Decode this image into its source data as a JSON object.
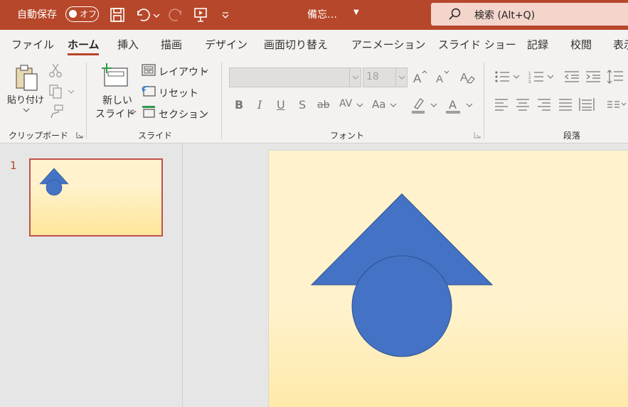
{
  "titlebar": {
    "autosave_label": "自動保存",
    "autosave_state": "オフ",
    "filename": "備忘…",
    "search_placeholder": "検索 (Alt+Q)",
    "accent_color": "#b7472a"
  },
  "tabs": [
    {
      "label": "ファイル",
      "active": false
    },
    {
      "label": "ホーム",
      "active": true
    },
    {
      "label": "挿入",
      "active": false
    },
    {
      "label": "描画",
      "active": false
    },
    {
      "label": "デザイン",
      "active": false
    },
    {
      "label": "画面切り替え",
      "active": false
    },
    {
      "label": "アニメーション",
      "active": false
    },
    {
      "label": "スライド ショー",
      "active": false
    },
    {
      "label": "記録",
      "active": false
    },
    {
      "label": "校閲",
      "active": false
    },
    {
      "label": "表示",
      "active": false
    }
  ],
  "ribbon": {
    "clipboard": {
      "paste_label_line1": "貼り付け",
      "group_label": "クリップボード"
    },
    "slides": {
      "new_slide_line1": "新しい",
      "new_slide_line2": "スライド",
      "layout_label": "レイアウト",
      "reset_label": "リセット",
      "section_label": "セクション",
      "group_label": "スライド"
    },
    "font": {
      "font_name": "",
      "font_size": "18",
      "group_label": "フォント",
      "buttons": [
        "B",
        "I",
        "U",
        "S",
        "ab",
        "AV",
        "Aa",
        "A"
      ]
    },
    "paragraph": {
      "group_label": "段落"
    }
  },
  "slides_panel": {
    "slide_number": "1"
  },
  "slide": {
    "background": "#fff2cc",
    "shape_fill": "#4472c4",
    "shape_stroke": "#2f528f",
    "shapes": [
      "triangle",
      "circle"
    ]
  }
}
